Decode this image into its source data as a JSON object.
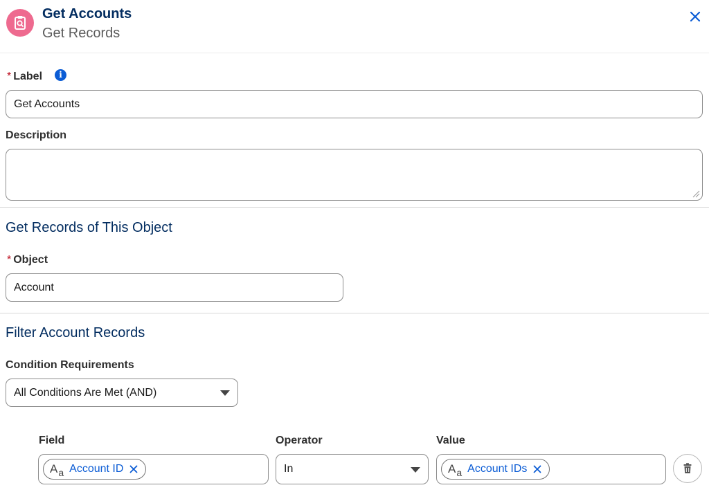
{
  "header": {
    "title": "Get Accounts",
    "subtitle": "Get Records",
    "icon": "get-records-icon",
    "icon_color": "#ee6a8f",
    "close_icon": "close-icon"
  },
  "form": {
    "required_marker": "*",
    "label": {
      "label": "Label",
      "value": "Get Accounts",
      "info_icon": "info-icon"
    },
    "description": {
      "label": "Description",
      "value": ""
    }
  },
  "object_section": {
    "heading": "Get Records of This Object",
    "object_label": "Object",
    "object_value": "Account"
  },
  "filter_section": {
    "heading": "Filter Account Records",
    "condition_label": "Condition Requirements",
    "condition_value": "All Conditions Are Met (AND)",
    "columns": {
      "field": "Field",
      "operator": "Operator",
      "value": "Value"
    },
    "row": {
      "field_pill": "Account ID",
      "operator": "In",
      "value_pill": "Account IDs",
      "delete_icon": "trash-icon"
    }
  },
  "colors": {
    "heading": "#032d60",
    "link": "#0b5cd5",
    "required": "#ba0517"
  }
}
